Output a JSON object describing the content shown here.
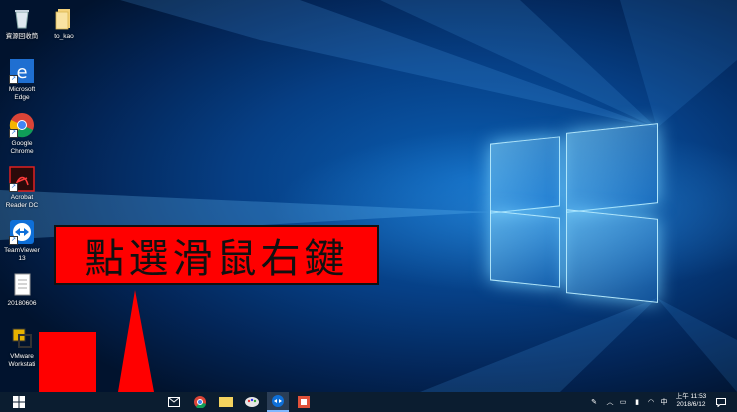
{
  "desktop": {
    "icons": [
      {
        "label": "資源回收筒",
        "icon": "recycle-bin-icon"
      },
      {
        "label": "to_kao",
        "icon": "folder-icon"
      },
      {
        "label": "Microsoft\nEdge",
        "icon": "edge-icon"
      },
      {
        "label": "Google\nChrome",
        "icon": "chrome-icon"
      },
      {
        "label": "Acrobat\nReader DC",
        "icon": "acrobat-icon"
      },
      {
        "label": "TeamViewer\n13",
        "icon": "teamviewer-icon"
      },
      {
        "label": "20180606",
        "icon": "document-icon"
      },
      {
        "label": "VMware\nWorkstati",
        "icon": "vmware-icon"
      }
    ]
  },
  "annotation": {
    "callout_text": "點選滑鼠右鍵",
    "color": "#ff0000"
  },
  "taskbar": {
    "pinned": [
      "start-icon",
      "task-view-icon",
      "file-explorer-icon",
      "store-icon",
      "mail-icon",
      "chrome-icon",
      "sticky-notes-icon",
      "paint-icon",
      "teamviewer-icon",
      "office-icon"
    ],
    "tray": {
      "ime": "中",
      "time": "上午 11:53",
      "date": "2018/6/12"
    }
  }
}
